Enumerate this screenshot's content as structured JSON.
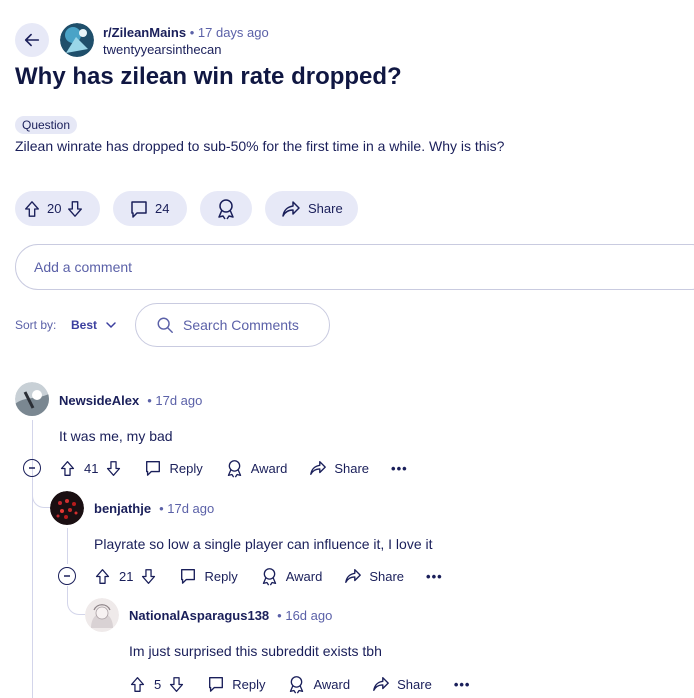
{
  "post": {
    "subreddit": "r/ZileanMains",
    "separator": "•",
    "age": "17 days ago",
    "author": "twentyyearsinthecan",
    "title": "Why has zilean win rate dropped?",
    "flair": "Question",
    "body": "Zilean winrate has dropped to sub-50% for the first time in a while. Why is this?",
    "votes": "20",
    "comments": "24",
    "share_label": "Share"
  },
  "comment_box": {
    "placeholder": "Add a comment"
  },
  "sort": {
    "label": "Sort by:",
    "value": "Best"
  },
  "search": {
    "placeholder": "Search Comments"
  },
  "actions": {
    "reply": "Reply",
    "award": "Award",
    "share": "Share",
    "more": "•••"
  },
  "comments": [
    {
      "user": "NewsideAlex",
      "age": "• 17d ago",
      "text": "It was me, my bad",
      "votes": "41"
    },
    {
      "user": "benjathje",
      "age": "• 17d ago",
      "text": "Playrate so low a single player can influence it, I love it",
      "votes": "21"
    },
    {
      "user": "NationalAsparagus138",
      "age": "• 16d ago",
      "text": "Im just surprised this subreddit exists tbh",
      "votes": "5"
    }
  ],
  "colors": {
    "pill_bg": "#e7e9f7",
    "text_navy": "#1a1f5a",
    "muted": "#5b61a8",
    "thread_line": "#d3d5ea"
  },
  "icons": [
    "back-arrow-icon",
    "upvote-icon",
    "downvote-icon",
    "comment-icon",
    "award-icon",
    "share-icon",
    "search-icon",
    "chevron-down-icon",
    "collapse-icon",
    "reply-icon",
    "more-icon"
  ]
}
